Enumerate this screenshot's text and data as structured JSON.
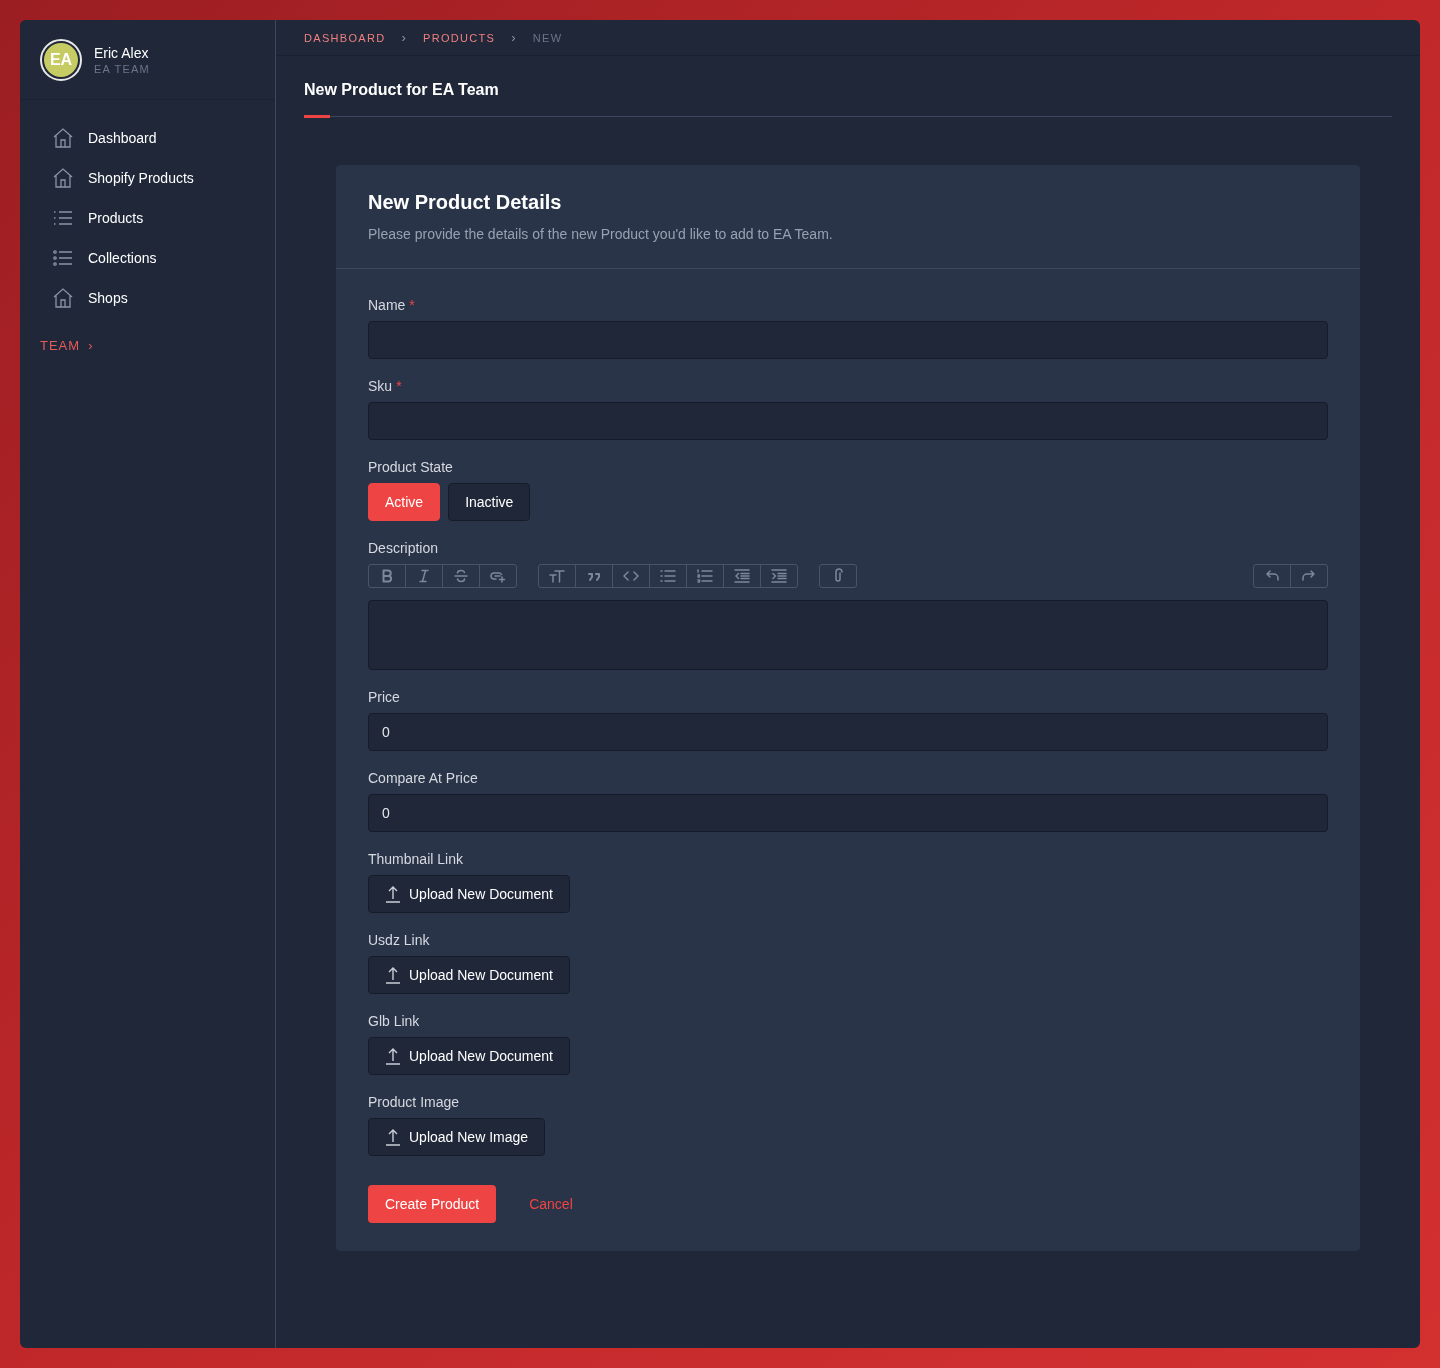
{
  "user": {
    "initials": "EA",
    "name": "Eric Alex",
    "team": "EA TEAM"
  },
  "sidebar": {
    "items": [
      {
        "label": "Dashboard",
        "kind": "house"
      },
      {
        "label": "Shopify Products",
        "kind": "house"
      },
      {
        "label": "Products",
        "kind": "list"
      },
      {
        "label": "Collections",
        "kind": "dotlist"
      },
      {
        "label": "Shops",
        "kind": "house"
      }
    ],
    "section": {
      "label": "TEAM",
      "chevron": "›"
    }
  },
  "breadcrumb": [
    {
      "label": "DASHBOARD",
      "current": false
    },
    {
      "label": "PRODUCTS",
      "current": false
    },
    {
      "label": "NEW",
      "current": true
    }
  ],
  "breadcrumb_separator": "›",
  "page_title": "New Product for EA Team",
  "card": {
    "title": "New Product Details",
    "subtitle": "Please provide the details of the new Product you'd like to add to EA Team.",
    "fields": [
      {
        "kind": "text",
        "label": "Name",
        "marker": "*"
      },
      {
        "kind": "text",
        "label": "Sku",
        "marker": "*"
      },
      {
        "kind": "segmented",
        "label": "Product State",
        "options": [
          {
            "label": "Active",
            "selected": true
          },
          {
            "label": "Inactive",
            "selected": false
          }
        ]
      },
      {
        "kind": "editor",
        "label": "Description"
      },
      {
        "kind": "text",
        "label": "Price",
        "value": "0"
      },
      {
        "kind": "text",
        "label": "Compare At Price",
        "value": "0"
      },
      {
        "kind": "upload",
        "label": "Thumbnail Link",
        "button": "Upload New Document"
      },
      {
        "kind": "upload",
        "label": "Usdz Link",
        "button": "Upload New Document"
      },
      {
        "kind": "upload",
        "label": "Glb Link",
        "button": "Upload New Document"
      },
      {
        "kind": "upload",
        "label": "Product Image",
        "button": "Upload New Image"
      }
    ],
    "actions": {
      "primary": "Create Product",
      "cancel": "Cancel"
    }
  }
}
